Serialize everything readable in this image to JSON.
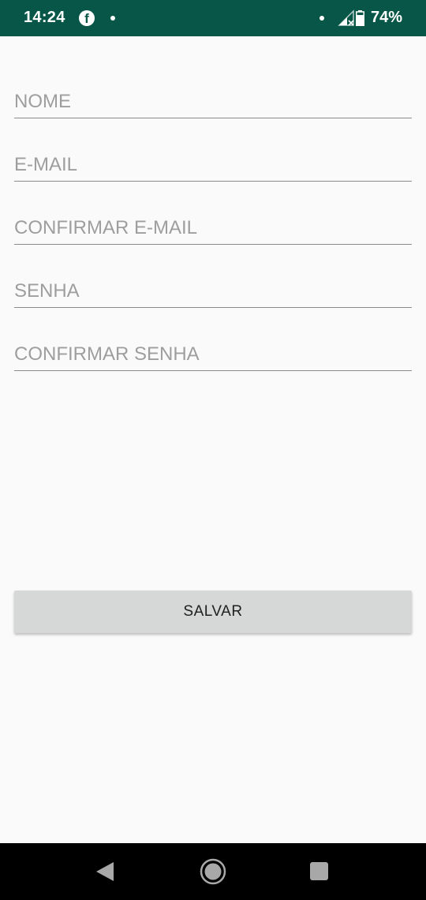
{
  "status_bar": {
    "time": "14:24",
    "battery": "74%",
    "background_color": "#075647",
    "icons": [
      "facebook-icon",
      "notification-dot-icon",
      "signal-icon",
      "battery-icon"
    ]
  },
  "form": {
    "fields": [
      {
        "placeholder": "NOME",
        "value": ""
      },
      {
        "placeholder": "E-MAIL",
        "value": ""
      },
      {
        "placeholder": "CONFIRMAR E-MAIL",
        "value": ""
      },
      {
        "placeholder": "SENHA",
        "value": ""
      },
      {
        "placeholder": "CONFIRMAR SENHA",
        "value": ""
      }
    ],
    "save_label": "SALVAR"
  },
  "nav_bar": {
    "icons": [
      "back-icon",
      "home-icon",
      "recents-icon"
    ]
  },
  "colors": {
    "background": "#fafafa",
    "button": "#d6d7d7",
    "placeholder": "#9e9e9e"
  }
}
